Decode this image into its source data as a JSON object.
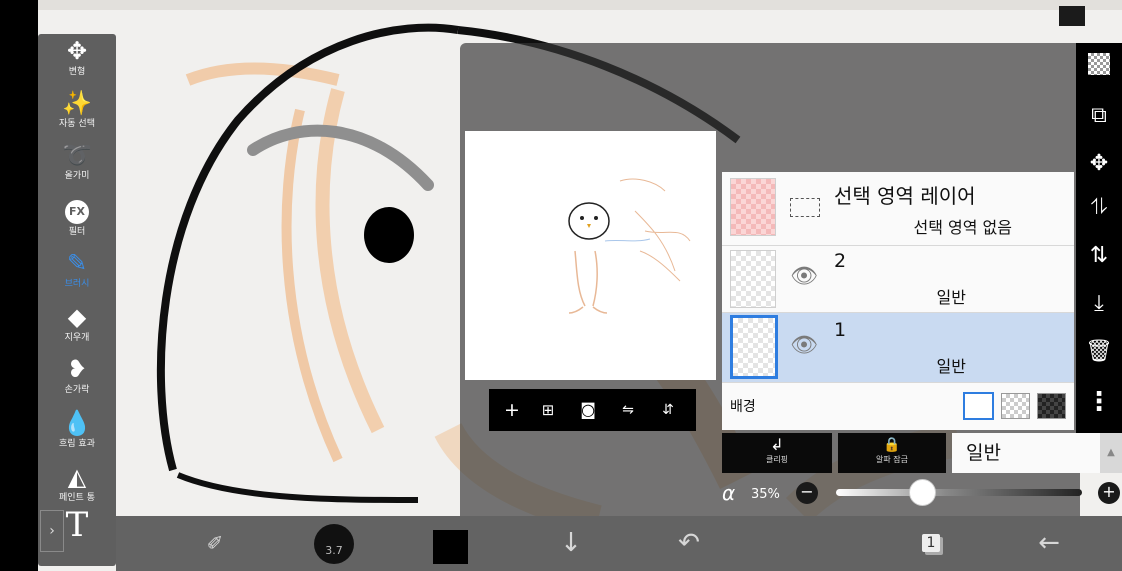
{
  "colors": {
    "accent": "#2e7de0",
    "toolbar_bg": "#5f5f5f",
    "layer_panel_bg": "#fafafa"
  },
  "tools": [
    {
      "label": "변형",
      "icon": "move-arrows-icon"
    },
    {
      "label": "자동 선택",
      "icon": "magic-wand-icon"
    },
    {
      "label": "올가미",
      "icon": "lasso-icon"
    },
    {
      "label": "필터",
      "icon": "fx-icon",
      "glyph": "FX"
    },
    {
      "label": "브러시",
      "icon": "brush-icon",
      "active": true
    },
    {
      "label": "지우개",
      "icon": "eraser-icon"
    },
    {
      "label": "손가락",
      "icon": "finger-icon"
    },
    {
      "label": "흐림 효과",
      "icon": "blur-drop-icon"
    },
    {
      "label": "페인트 통",
      "icon": "paint-bucket-icon"
    },
    {
      "label": "",
      "icon": "text-tool-icon",
      "glyph": "T"
    }
  ],
  "bottom_bar": {
    "brush_size": "3.7",
    "current_color": "#000000",
    "layer_count": "1"
  },
  "layers": {
    "selection_layer": {
      "title": "선택 영역 레이어",
      "subtitle": "선택 영역 없음"
    },
    "items": [
      {
        "name": "2",
        "mode": "일반",
        "visible": true,
        "selected": false
      },
      {
        "name": "1",
        "mode": "일반",
        "visible": true,
        "selected": true
      }
    ],
    "background_label": "배경"
  },
  "layer_controls": {
    "clip_label": "클리핑",
    "alpha_lock_label": "알파 잠금",
    "blend_mode": "일반",
    "opacity_symbol": "α",
    "opacity": "35%",
    "opacity_value": 0.35
  }
}
